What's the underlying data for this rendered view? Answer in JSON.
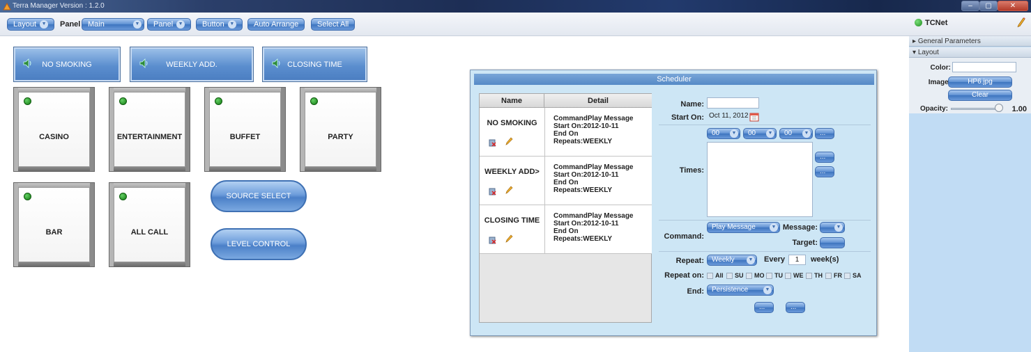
{
  "window": {
    "title": "Terra Manager Version : 1.2.0",
    "minimize_label": "–",
    "maximize_label": "▢",
    "close_label": "✕"
  },
  "toolbar": {
    "layout_label": "Layout",
    "panel_label": "Panel",
    "main_select": "Main",
    "panel_button": "Panel",
    "button_button": "Button",
    "auto_arrange": "Auto Arrange",
    "select_all": "Select All",
    "connection": "TCNet",
    "connection_color": "#1d8a1d"
  },
  "panel": {
    "top_buttons": [
      "NO SMOKING",
      "WEEKLY ADD.",
      "CLOSING TIME"
    ],
    "zones_row1": [
      "CASINO",
      "ENTERTAINMENT",
      "BUFFET",
      "PARTY"
    ],
    "zones_row2": [
      "BAR",
      "ALL CALL"
    ],
    "source_select": "SOURCE SELECT",
    "level_control": "LEVEL CONTROL"
  },
  "scheduler": {
    "title": "Scheduler",
    "columns": [
      "Name",
      "Detail"
    ],
    "rows": [
      {
        "name": "NO SMOKING",
        "detail": [
          "CommandPlay Message",
          "Start On:2012-10-11",
          "End On",
          "Repeats:WEEKLY"
        ]
      },
      {
        "name": "WEEKLY ADD>",
        "detail": [
          "CommandPlay Message",
          "Start On:2012-10-11",
          "End On",
          "Repeats:WEEKLY"
        ]
      },
      {
        "name": "CLOSING TIME",
        "detail": [
          "CommandPlay Message",
          "Start On:2012-10-11",
          "End On",
          "Repeats:WEEKLY"
        ]
      }
    ],
    "form": {
      "name_label": "Name:",
      "name_value": "",
      "start_on_label": "Start On:",
      "start_on_value": "Oct 11, 2012",
      "hour": "00",
      "minute": "00",
      "second": "00",
      "ellipsis": "...",
      "times_label": "Times:",
      "command_label": "Command:",
      "command_value": "Play Message",
      "message_label": "Message:",
      "target_label": "Target:",
      "repeat_label": "Repeat:",
      "repeat_value": "Weekly",
      "every_label": "Every",
      "every_value": "1",
      "weeks_label": "week(s)",
      "repeat_on_label": "Repeat on:",
      "days": [
        "All",
        "SU",
        "MO",
        "TU",
        "WE",
        "TH",
        "FR",
        "SA"
      ],
      "end_label": "End:",
      "end_value": "Persistence"
    }
  },
  "properties": {
    "general_header": "General Parameters",
    "layout_header": "Layout",
    "color_label": "Color:",
    "color_value": "",
    "image_label": "Image:",
    "image_value": "HP6.jpg",
    "clear_label": "Clear",
    "opacity_label": "Opacity:",
    "opacity_value": "1.00"
  }
}
